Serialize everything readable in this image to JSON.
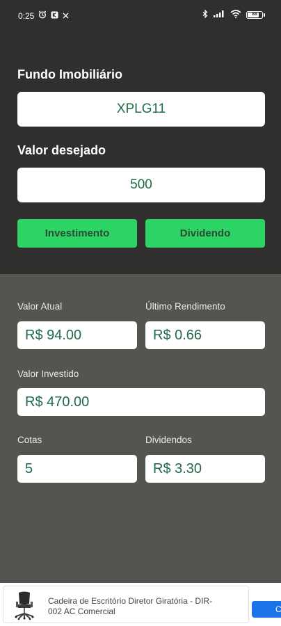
{
  "status": {
    "time": "0:25",
    "battery": "88"
  },
  "form": {
    "fund_label": "Fundo Imobiliário",
    "fund_value": "XPLG11",
    "value_label": "Valor desejado",
    "value_value": "500",
    "invest_button": "Investimento",
    "dividend_button": "Dividendo"
  },
  "results": {
    "current_value_label": "Valor Atual",
    "current_value": "R$ 94.00",
    "last_yield_label": "Último Rendimento",
    "last_yield": "R$ 0.66",
    "invested_label": "Valor Investido",
    "invested": "R$ 470.00",
    "shares_label": "Cotas",
    "shares": "5",
    "dividends_label": "Dividendos",
    "dividends": "R$ 3.30"
  },
  "ad": {
    "text": "Cadeira de Escritório Diretor Giratória - DIR-002 AC Comercial",
    "button_label": "C"
  },
  "colors": {
    "top_bg": "#302f2d",
    "bottom_bg": "#555451",
    "button_green": "#2bd464",
    "value_text": "#1f6b45"
  }
}
